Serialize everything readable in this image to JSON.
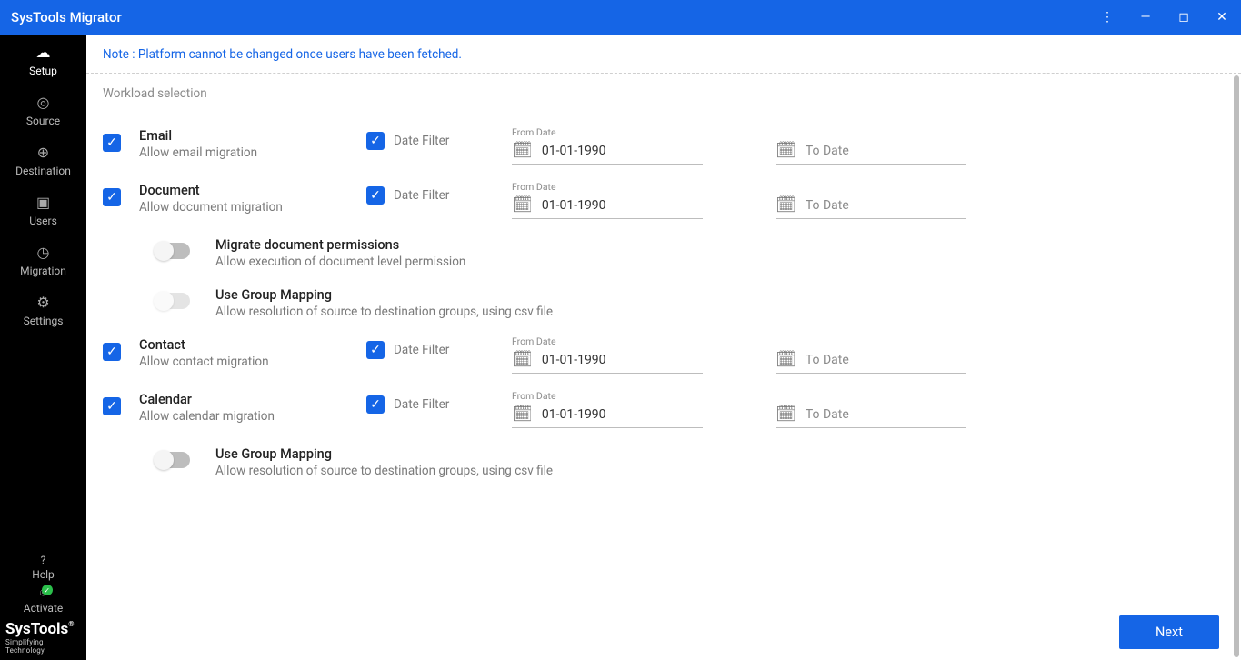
{
  "window": {
    "title": "SysTools Migrator"
  },
  "sidebar": {
    "items": [
      {
        "label": "Setup",
        "icon": "cloud",
        "active": true
      },
      {
        "label": "Source",
        "icon": "target"
      },
      {
        "label": "Destination",
        "icon": "locate"
      },
      {
        "label": "Users",
        "icon": "account"
      },
      {
        "label": "Migration",
        "icon": "clock"
      },
      {
        "label": "Settings",
        "icon": "gear"
      }
    ],
    "help": "Help",
    "activate": "Activate",
    "brand_line1": "SysTools",
    "brand_line2": "Simplifying Technology"
  },
  "note": "Note : Platform cannot be changed once users have been fetched.",
  "section_label": "Workload selection",
  "from_date_label": "From Date",
  "date_filter_label": "Date Filter",
  "to_date_placeholder": "To Date",
  "next_button": "Next",
  "workloads": [
    {
      "key": "email",
      "title": "Email",
      "subtitle": "Allow email migration",
      "checked": true,
      "date_filter": true,
      "from_date": "01-01-1990",
      "to_date": "",
      "sub_options": []
    },
    {
      "key": "document",
      "title": "Document",
      "subtitle": "Allow document migration",
      "checked": true,
      "date_filter": true,
      "from_date": "01-01-1990",
      "to_date": "",
      "sub_options": [
        {
          "title": "Migrate document permissions",
          "subtitle": "Allow execution of document level permission",
          "state": "off"
        },
        {
          "title": "Use Group Mapping",
          "subtitle": "Allow resolution of source to destination groups, using csv file",
          "state": "disabled"
        }
      ]
    },
    {
      "key": "contact",
      "title": "Contact",
      "subtitle": "Allow contact migration",
      "checked": true,
      "date_filter": true,
      "from_date": "01-01-1990",
      "to_date": "",
      "sub_options": []
    },
    {
      "key": "calendar",
      "title": "Calendar",
      "subtitle": "Allow calendar migration",
      "checked": true,
      "date_filter": true,
      "from_date": "01-01-1990",
      "to_date": "",
      "sub_options": [
        {
          "title": "Use Group Mapping",
          "subtitle": "Allow resolution of source to destination groups, using csv file",
          "state": "off"
        }
      ]
    }
  ]
}
